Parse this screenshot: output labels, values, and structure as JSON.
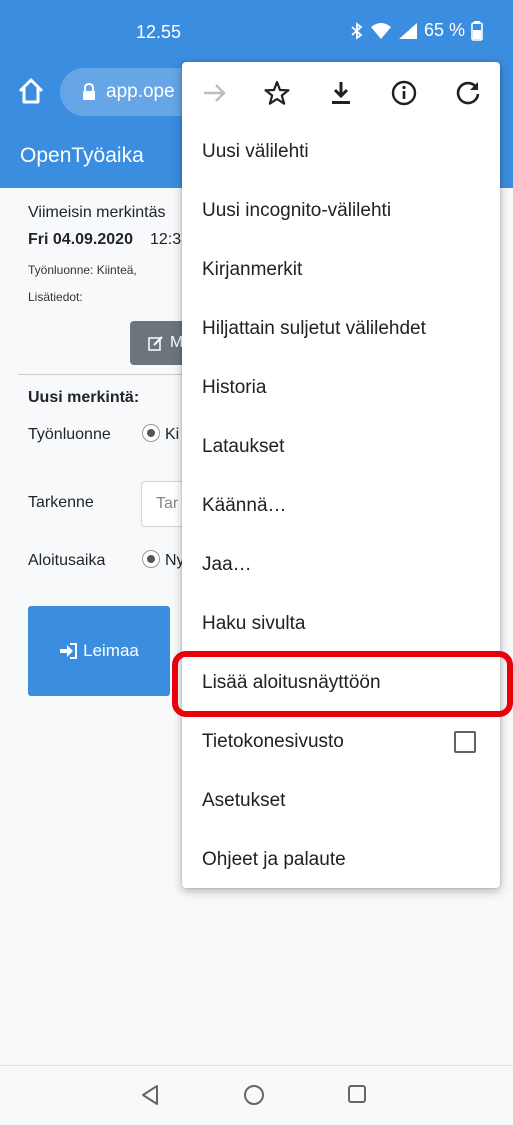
{
  "status_bar": {
    "time": "12.55",
    "battery": "65 %"
  },
  "browser": {
    "url": "app.ope"
  },
  "app": {
    "brand": "OpenTyöaika"
  },
  "page": {
    "last_entry_label": "Viimeisin merkintäs",
    "last_entry_date": "Fri 04.09.2020",
    "last_entry_time": "12:3",
    "work_type_info": "Työnluonne: Kiinteä,",
    "additional_info": "Lisätiedot:",
    "edit_button": "M",
    "new_entry_title": "Uusi merkintä:",
    "work_type_label": "Työnluonne",
    "work_type_option": "Ki",
    "detail_label": "Tarkenne",
    "detail_placeholder": "Tar",
    "start_time_label": "Aloitusaika",
    "start_time_option": "Ny",
    "stamp_button": "Leimaa"
  },
  "menu": {
    "items": [
      "Uusi välilehti",
      "Uusi incognito-välilehti",
      "Kirjanmerkit",
      "Hiljattain suljetut välilehdet",
      "Historia",
      "Lataukset",
      "Käännä…",
      "Jaa…",
      "Haku sivulta",
      "Lisää aloitusnäyttöön",
      "Tietokonesivusto",
      "Asetukset",
      "Ohjeet ja palaute"
    ]
  },
  "colors": {
    "primary": "#3b8de0",
    "highlight": "#e8000b",
    "secondary_button": "#6c757d"
  },
  "icons": [
    "forward-icon",
    "star-icon",
    "download-icon",
    "info-icon",
    "refresh-icon",
    "home-icon",
    "lock-icon",
    "edit-icon",
    "login-icon",
    "back-nav-icon",
    "home-nav-icon",
    "recents-nav-icon"
  ]
}
